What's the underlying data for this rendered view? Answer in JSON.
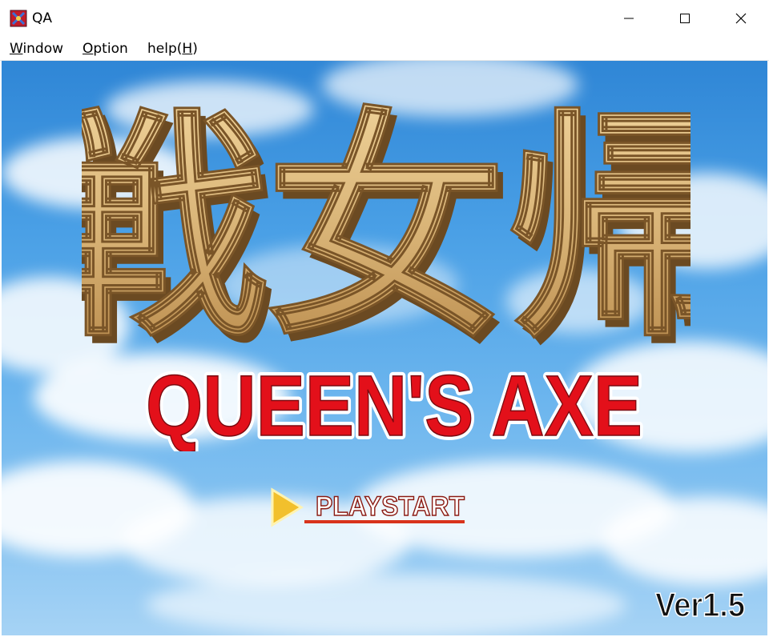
{
  "window": {
    "title": "QA",
    "controls": [
      "minimize",
      "maximize",
      "close"
    ]
  },
  "menu": {
    "items": [
      {
        "label": "Window",
        "mnemonic": "W",
        "rest": "indow"
      },
      {
        "label": "Option",
        "mnemonic": "O",
        "rest": "ption"
      },
      {
        "label": "help(H)",
        "prefix": "help(",
        "mnemonic": "H",
        "suffix": ")"
      }
    ]
  },
  "game": {
    "logo_kanji": "戦女帰",
    "title": "QUEEN'S AXE",
    "play_label": "PLAYSTART",
    "version": "Ver1.5"
  },
  "colors": {
    "sky_top": "#2f86d6",
    "sky_bottom": "#a6d3f5",
    "logo_gold": "#d9b477",
    "logo_shadow": "#6b4a22",
    "title_red": "#e3101a",
    "play_underline": "#d8331c",
    "arrow_yellow": "#f2c02c"
  }
}
